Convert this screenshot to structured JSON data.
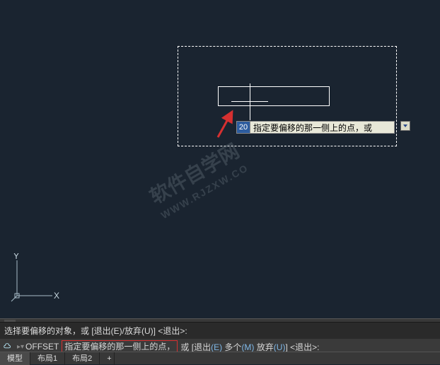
{
  "dynamic_input": {
    "value": "20",
    "tooltip": "指定要偏移的那一侧上的点，或"
  },
  "watermark": {
    "line1": "软件自学网",
    "line2": "WWW.RJZXW.CO"
  },
  "ucs": {
    "x_label": "X",
    "y_label": "Y"
  },
  "command": {
    "history": "选择要偏移的对象，或 [退出(E)/放弃(U)] <退出>:",
    "name": "OFFSET",
    "highlighted": "指定要偏移的那一侧上的点，",
    "rest_prefix": "或 [",
    "opt_exit": "退出",
    "opt_exit_key": "(E)",
    "opt_multi": " 多个",
    "opt_multi_key": "(M)",
    "opt_undo": " 放弃",
    "opt_undo_key": "(U)",
    "rest_suffix": "] <退出>:"
  },
  "tabs": {
    "model": "模型",
    "layout1": "布局1",
    "layout2": "布局2",
    "plus": "+"
  }
}
